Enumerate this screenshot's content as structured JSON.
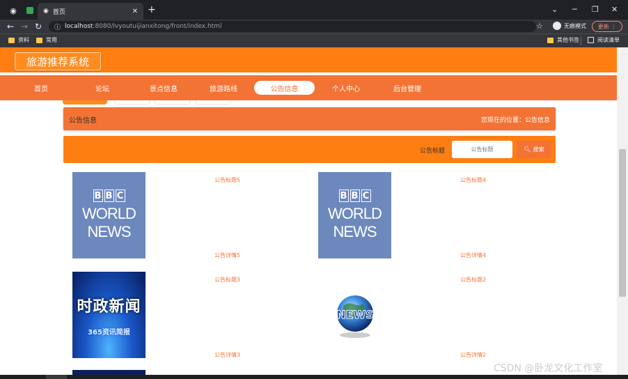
{
  "browser": {
    "tab_title": "首页",
    "new_tab": "+",
    "url_host": "localhost",
    "url_path": ":8080/lvyoutuijianxitong/front/index.html",
    "incognito_label": "无痕模式",
    "update_label": "更新",
    "bookmarks": [
      {
        "label": "资料"
      },
      {
        "label": "常用"
      }
    ],
    "other_bookmarks": "其他书签",
    "reading_list": "阅读清单"
  },
  "site": {
    "logo": "旅游推荐系统",
    "nav": [
      {
        "label": "首页",
        "active": false
      },
      {
        "label": "论坛",
        "active": false
      },
      {
        "label": "景点信息",
        "active": false
      },
      {
        "label": "旅游路线",
        "active": false
      },
      {
        "label": "公告信息",
        "active": true
      },
      {
        "label": "个人中心",
        "active": false
      },
      {
        "label": "后台管理",
        "active": false
      }
    ]
  },
  "breadcrumb": {
    "title": "公告信息",
    "location": "您现在的位置：公告信息"
  },
  "search": {
    "label": "公告标题",
    "placeholder": "公告标题",
    "button": "搜索"
  },
  "notices": [
    {
      "title": "公告标题5",
      "detail": "公告详情5",
      "image": "bbc-world-news"
    },
    {
      "title": "公告标题4",
      "detail": "公告详情4",
      "image": "bbc-world-news"
    },
    {
      "title": "公告标题3",
      "detail": "公告详情3",
      "image": "politics-news"
    },
    {
      "title": "公告标题2",
      "detail": "公告详情2",
      "image": "news-globe"
    }
  ],
  "images": {
    "bbc_letters": [
      "B",
      "B",
      "C"
    ],
    "bbc_line1": "WORLD",
    "bbc_line2": "NEWS",
    "politics_main": "时政新闻",
    "politics_sub": "365资讯简报",
    "globe_text": "NEWS"
  },
  "watermark": "CSDN @卧龙文化工作室",
  "colors": {
    "header_orange": "#ff7e12",
    "nav_orange": "#f37335",
    "link_orange": "#f37335"
  }
}
